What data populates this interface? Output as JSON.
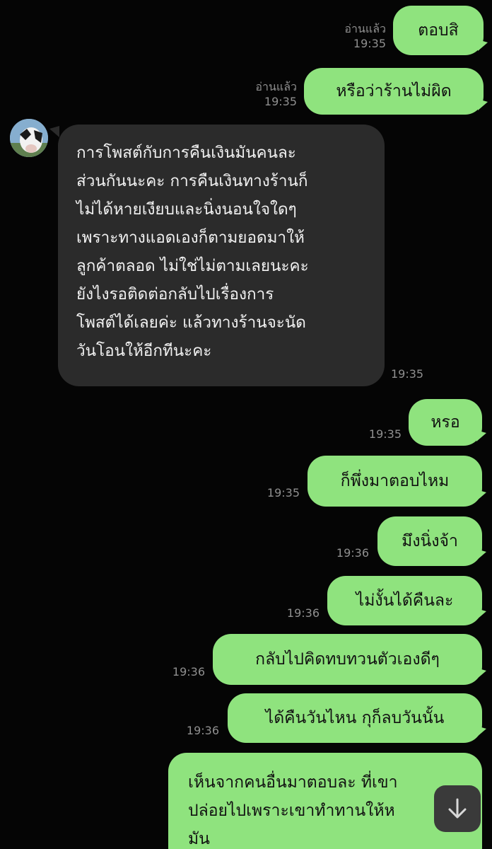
{
  "messages": [
    {
      "text": "ตอบสิ",
      "status": "อ่านแล้ว",
      "time": "19:35"
    },
    {
      "text": "หรือว่าร้านไม่ผิด",
      "status": "อ่านแล้ว",
      "time": "19:35"
    },
    {
      "lines": [
        "การโพสต์กับการคืนเงินมันคนละ",
        "ส่วนกันนะคะ การคืนเงินทางร้านก็",
        "ไม่ได้หายเงียบและนิ่งนอนใจใดๆ",
        "เพราะทางแอดเองก็ตามยอดมาให้",
        "ลูกค้าตลอด ไม่ใช่ไม่ตามเลยนะคะ",
        "ยังไงรอติดต่อกลับไปเรื่องการ",
        "โพสต์ได้เลยค่ะ แล้วทางร้านจะนัด",
        "วันโอนให้อีกทีนะคะ"
      ],
      "time": "19:35"
    },
    {
      "text": "หรอ",
      "time": "19:35"
    },
    {
      "text": "ก็พึ่งมาตอบไหม",
      "time": "19:35"
    },
    {
      "text": "มึงนิ่งจ้า",
      "time": "19:36"
    },
    {
      "text": "ไม่งั้นได้คืนละ",
      "time": "19:36"
    },
    {
      "text": "กลับไปคิดทบทวนตัวเองดีๆ",
      "time": "19:36"
    },
    {
      "text": "ได้คืนวันไหน กุก็ลบวันนั้น",
      "time": "19:36"
    },
    {
      "lines": [
        "เห็นจากคนอื่นมาตอบละ ที่เขา",
        "ปล่อยไปเพราะเขาทำทานให้ห",
        "มัน"
      ]
    }
  ],
  "colors": {
    "background": "#050505",
    "outgoing_bubble": "#8fe37e",
    "incoming_bubble": "#2b2b2b",
    "meta_text": "#8f8f8f"
  },
  "icons": {
    "avatar": "cow-avatar",
    "scroll_button": "arrow-down-icon"
  }
}
